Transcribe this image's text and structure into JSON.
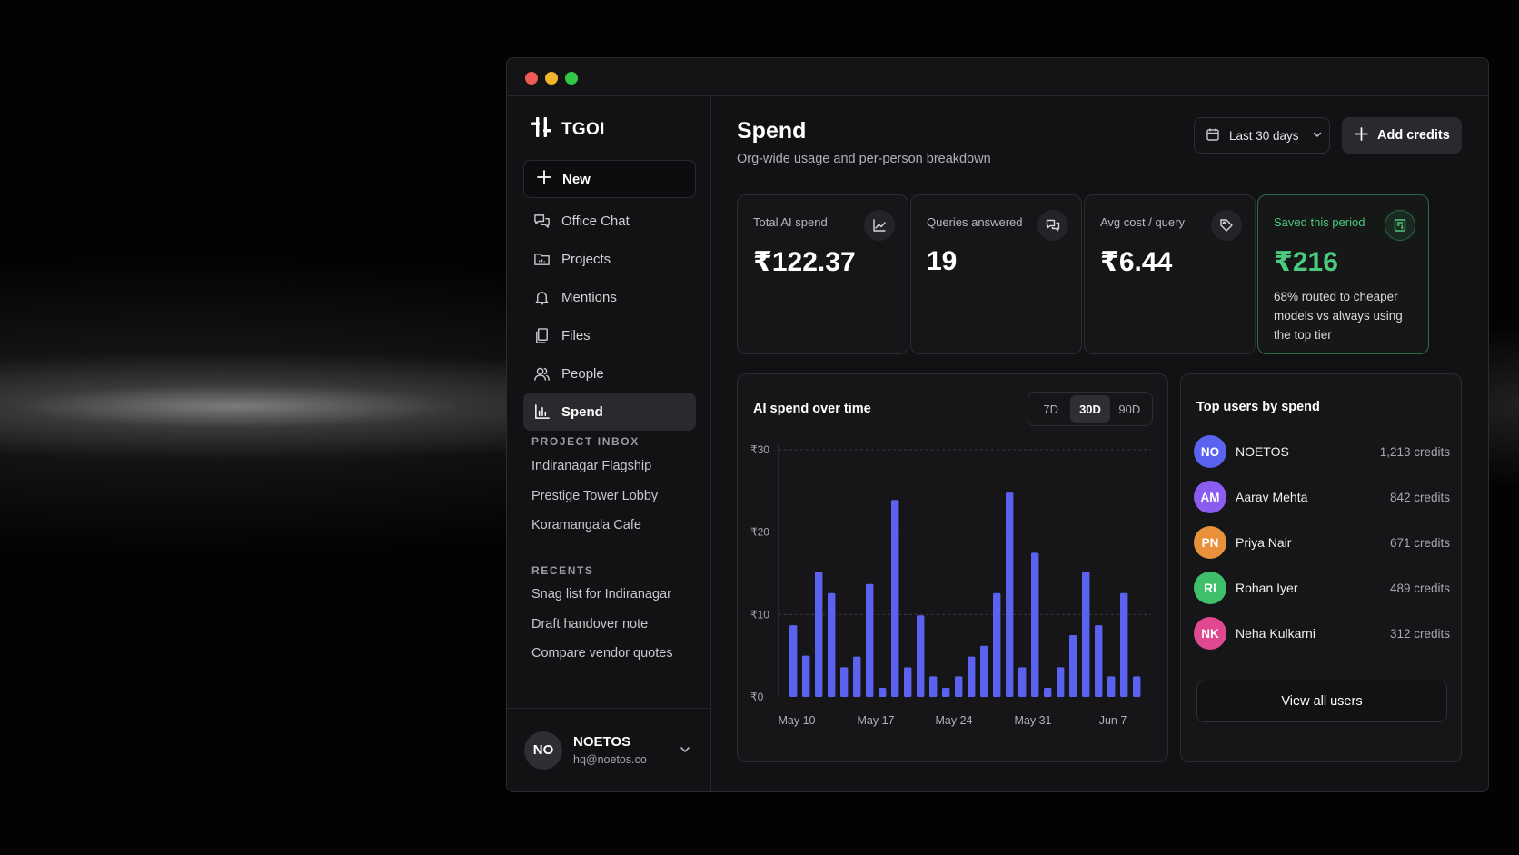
{
  "window": {
    "controls": [
      "close",
      "minimize",
      "maximize"
    ]
  },
  "brand": {
    "name": "TGOI",
    "icon": "hash-logo-icon"
  },
  "sidebar": {
    "new_label": "New",
    "nav": [
      {
        "label": "Office Chat",
        "icon": "chat-icon",
        "active": false
      },
      {
        "label": "Projects",
        "icon": "folder-icon",
        "active": false
      },
      {
        "label": "Mentions",
        "icon": "bell-icon",
        "active": false
      },
      {
        "label": "Files",
        "icon": "files-icon",
        "active": false
      },
      {
        "label": "People",
        "icon": "people-icon",
        "active": false
      },
      {
        "label": "Spend",
        "icon": "bar-chart-icon",
        "active": true
      }
    ],
    "project_inbox_label": "PROJECT INBOX",
    "projects": [
      "Indiranagar Flagship",
      "Prestige Tower Lobby",
      "Koramangala Cafe"
    ],
    "recents_label": "RECENTS",
    "recents": [
      "Snag list for Indiranagar",
      "Draft handover note",
      "Compare vendor quotes"
    ],
    "user": {
      "initials": "NO",
      "name": "NOETOS",
      "email": "hq@noetos.co"
    }
  },
  "header": {
    "title": "Spend",
    "subtitle": "Org-wide usage and per-person breakdown",
    "range_label": "Last 30 days",
    "add_credits_label": "Add credits"
  },
  "stats": [
    {
      "label": "Total AI spend",
      "value": "₹122.37",
      "icon": "trend-line-icon"
    },
    {
      "label": "Queries answered",
      "value": "19",
      "icon": "chat-bubbles-icon"
    },
    {
      "label": "Avg cost / query",
      "value": "₹6.44",
      "icon": "tag-icon"
    },
    {
      "label": "Saved this period",
      "value": "₹216",
      "note": "68% routed to cheaper models vs always using the top tier",
      "icon": "savings-icon",
      "highlight": true
    }
  ],
  "chart_card": {
    "title": "AI spend over time",
    "ranges": [
      "7D",
      "30D",
      "90D"
    ],
    "active_range": "30D"
  },
  "chart_data": {
    "type": "bar",
    "title": "AI spend over time",
    "x_tick_labels": [
      "May 10",
      "May 17",
      "May 24",
      "May 31",
      "Jun 7"
    ],
    "y_tick_labels": [
      "₹0",
      "₹10",
      "₹20",
      "₹30"
    ],
    "ylim": [
      0,
      30
    ],
    "grid": true,
    "color": "#5b62f0",
    "values": [
      8.7,
      5,
      15.2,
      12.6,
      3.6,
      4.9,
      13.7,
      1.1,
      23.9,
      3.6,
      9.9,
      2.5,
      1.1,
      2.5,
      4.9,
      6.2,
      12.6,
      24.8,
      3.6,
      17.5,
      1.1,
      3.6,
      7.5,
      15.2,
      8.7,
      2.5,
      12.6,
      2.5
    ]
  },
  "top_users": {
    "title": "Top users by spend",
    "users": [
      {
        "initials": "NO",
        "name": "NOETOS",
        "credits": "1,213 credits",
        "color": "#5b62f0"
      },
      {
        "initials": "AM",
        "name": "Aarav Mehta",
        "credits": "842 credits",
        "color": "#8a5cf0"
      },
      {
        "initials": "PN",
        "name": "Priya Nair",
        "credits": "671 credits",
        "color": "#e8913a"
      },
      {
        "initials": "RI",
        "name": "Rohan Iyer",
        "credits": "489 credits",
        "color": "#3fbf6a"
      },
      {
        "initials": "NK",
        "name": "Neha Kulkarni",
        "credits": "312 credits",
        "color": "#e0488f"
      }
    ],
    "view_all_label": "View all users"
  },
  "colors": {
    "accent": "#5b62f0",
    "success": "#4cc97e",
    "window_bg": "#121214"
  }
}
